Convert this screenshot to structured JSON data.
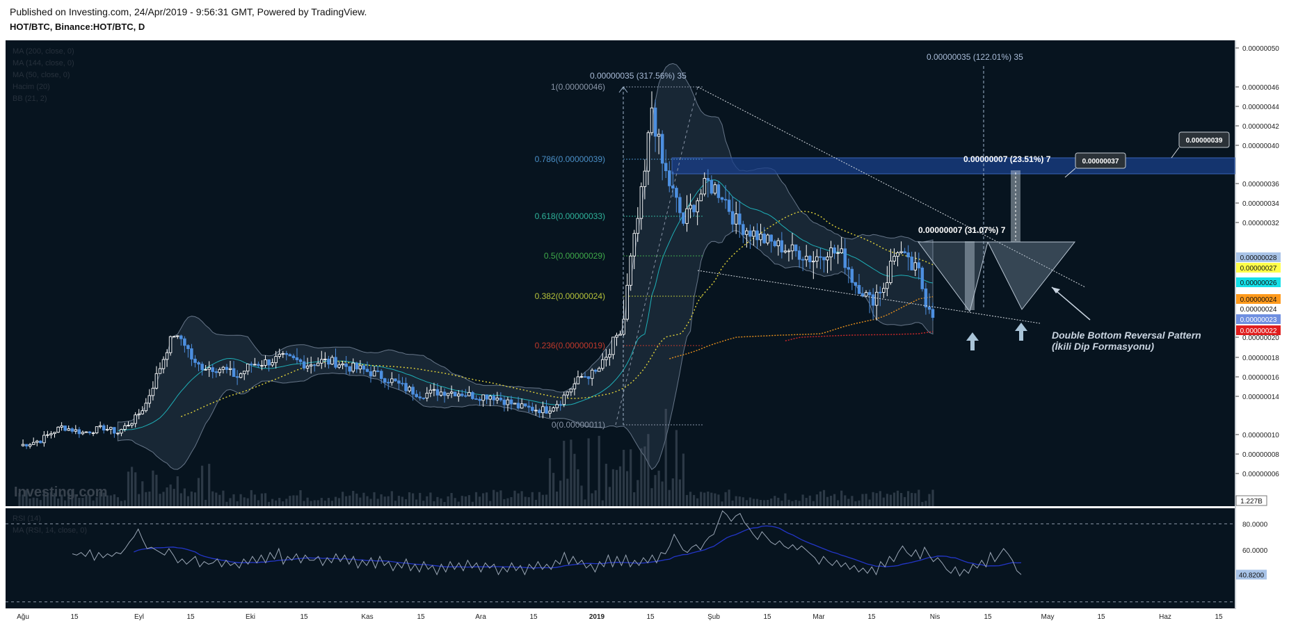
{
  "header": {
    "published": "Published on Investing.com, 24/Apr/2019 - 9:56:31 GMT, Powered by TradingView.",
    "symbol": "HOT/BTC, Binance:HOT/BTC, D"
  },
  "legend": [
    "MA (200, close, 0)",
    "MA (144, close, 0)",
    "MA (50, close, 0)",
    "Hacim (20)",
    "BB (21, 2)"
  ],
  "watermark": "Investing.com",
  "rsi_legend": [
    "RSI (14)",
    "MA (RSI, 14, close, 0)"
  ],
  "colors": {
    "background": "#07141f",
    "candle_up": "#ffffff",
    "candle_down": "#4d8fe0",
    "ma200": "#d42a2a",
    "ma144": "#e8901c",
    "ma50": "#e3d43a",
    "bb_fill": "#1b2a3a",
    "fib_0236": "#c0392b",
    "fib_0382": "#b5c23a",
    "fib_05": "#3fa94a",
    "fib_0618": "#2fb39a",
    "fib_0786": "#4a8fc7",
    "resistance_zone": "#1a3f8a"
  },
  "chart_data": {
    "type": "candlestick",
    "symbol": "HOT/BTC",
    "interval": "D",
    "y_axis_ticks": [
      "0.00000050",
      "0.00000046",
      "0.00000044",
      "0.00000042",
      "0.00000040",
      "0.00000036",
      "0.00000034",
      "0.00000032",
      "0.00000020",
      "0.00000018",
      "0.00000016",
      "0.00000014",
      "0.00000010",
      "0.00000008",
      "0.00000006"
    ],
    "x_axis_labels": [
      "Ağu",
      "15",
      "Eyl",
      "15",
      "Eki",
      "15",
      "Kas",
      "15",
      "Ara",
      "15",
      "2019",
      "15",
      "Şub",
      "15",
      "Mar",
      "15",
      "Nis",
      "15",
      "May",
      "15",
      "Haz",
      "15"
    ],
    "price_labels": [
      {
        "text": "0.00000028",
        "bg": "#a9c4e8",
        "fg": "#111"
      },
      {
        "text": "0.00000027",
        "bg": "#ffff4a",
        "fg": "#111"
      },
      {
        "text": "0.00000026",
        "bg": "#14e0e8",
        "fg": "#111"
      },
      {
        "text": "0.00000024",
        "bg": "#ff9a1c",
        "fg": "#111"
      },
      {
        "text": "0.00000024",
        "bg": "#ffffff",
        "fg": "#111"
      },
      {
        "text": "0.00000023",
        "bg": "#6f8fe0",
        "fg": "#fff"
      },
      {
        "text": "0.00000022",
        "bg": "#e01e1e",
        "fg": "#fff"
      }
    ],
    "volume_label": "1.227B",
    "fibonacci": [
      {
        "level": "1(0.00000046)",
        "color": "#8a96a8"
      },
      {
        "level": "0.786(0.00000039)",
        "color": "#4a8fc7"
      },
      {
        "level": "0.618(0.00000033)",
        "color": "#2fb39a"
      },
      {
        "level": "0.5(0.00000029)",
        "color": "#3fa94a"
      },
      {
        "level": "0.382(0.00000024)",
        "color": "#b5c23a"
      },
      {
        "level": "0.236(0.00000019)",
        "color": "#c0392b"
      },
      {
        "level": "0(0.00000011)",
        "color": "#8a96a8"
      }
    ],
    "measurements": [
      "0.00000035 (317.56%) 35",
      "0.00000035 (122.01%) 35",
      "0.00000007 (23.51%) 7",
      "0.00000007 (31.07%) 7"
    ],
    "callouts": [
      "0.00000039",
      "0.00000037"
    ],
    "annotation": [
      "Double Bottom Reversal Pattern",
      "(İkili Dip Formasyonu)"
    ],
    "rsi": {
      "y_ticks": [
        "80.0000",
        "60.0000"
      ],
      "current": "40.8200",
      "upper": 80,
      "lower": 20,
      "range": [
        15,
        92
      ],
      "values": [
        57,
        56,
        58,
        55,
        60,
        52,
        58,
        54,
        57,
        55,
        58,
        57,
        61,
        66,
        70,
        76,
        68,
        61,
        62,
        60,
        58,
        56,
        61,
        56,
        50,
        53,
        49,
        52,
        55,
        47,
        51,
        49,
        50,
        53,
        47,
        52,
        48,
        50,
        46,
        53,
        49,
        55,
        50,
        56,
        50,
        58,
        53,
        61,
        49,
        55,
        52,
        57,
        50,
        56,
        52,
        52,
        55,
        48,
        54,
        50,
        57,
        51,
        56,
        49,
        55,
        46,
        52,
        48,
        54,
        46,
        55,
        48,
        51,
        44,
        50,
        46,
        53,
        44,
        49,
        43,
        51,
        45,
        48,
        41,
        49,
        43,
        51,
        45,
        50,
        44,
        52,
        46,
        50,
        43,
        50,
        46,
        49,
        41,
        47,
        43,
        50,
        44,
        48,
        41,
        49,
        45,
        51,
        45,
        49,
        45,
        52,
        49,
        58,
        49,
        55,
        49,
        52,
        46,
        49,
        43,
        51,
        47,
        56,
        47,
        55,
        48,
        56,
        47,
        52,
        48,
        54,
        50,
        56,
        50,
        58,
        57,
        63,
        72,
        66,
        60,
        58,
        62,
        64,
        60,
        66,
        70,
        72,
        81,
        90,
        87,
        82,
        86,
        88,
        81,
        77,
        72,
        68,
        74,
        70,
        66,
        64,
        67,
        63,
        61,
        64,
        60,
        63,
        60,
        57,
        54,
        49,
        55,
        51,
        48,
        52,
        47,
        50,
        45,
        48,
        43,
        46,
        42,
        47,
        41,
        51,
        47,
        55,
        51,
        58,
        63,
        58,
        55,
        60,
        53,
        62,
        56,
        51,
        54,
        50,
        45,
        42,
        47,
        40,
        45,
        42,
        49,
        46,
        52,
        47,
        58,
        51,
        56,
        61,
        57,
        52,
        44,
        41
      ]
    }
  }
}
